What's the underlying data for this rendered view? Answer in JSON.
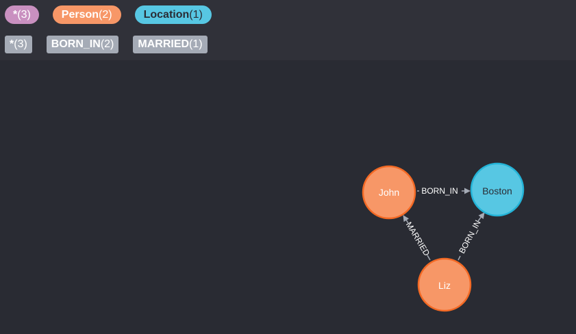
{
  "node_labels": [
    {
      "name": "*",
      "count": "(3)"
    },
    {
      "name": "Person",
      "count": "(2)"
    },
    {
      "name": "Location",
      "count": "(1)"
    }
  ],
  "relationship_types": [
    {
      "name": "*",
      "count": "(3)"
    },
    {
      "name": "BORN_IN",
      "count": "(2)"
    },
    {
      "name": "MARRIED",
      "count": "(1)"
    }
  ],
  "graph": {
    "nodes": [
      {
        "id": "john",
        "label": "John",
        "type": "Person"
      },
      {
        "id": "boston",
        "label": "Boston",
        "type": "Location"
      },
      {
        "id": "liz",
        "label": "Liz",
        "type": "Person"
      }
    ],
    "relationships": [
      {
        "from": "john",
        "to": "boston",
        "type": "BORN_IN"
      },
      {
        "from": "liz",
        "to": "john",
        "type": "MARRIED"
      },
      {
        "from": "liz",
        "to": "boston",
        "type": "BORN_IN"
      }
    ]
  },
  "colors": {
    "all": "#c990c0",
    "person": "#f79767",
    "person_border": "#f36924",
    "location": "#57c7e3",
    "location_border": "#23b3d7",
    "relationship": "#a5abb6",
    "background": "#292b33",
    "toolbar": "#303139"
  }
}
